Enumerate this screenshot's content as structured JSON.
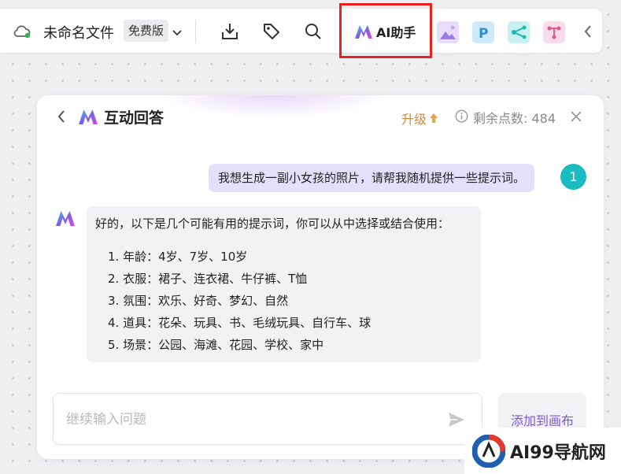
{
  "toolbar": {
    "file_name": "未命名文件",
    "plan_badge": "免费版",
    "ai_label": "AI助手",
    "icons": [
      "cloud-sync-icon",
      "chevron-down-icon",
      "download-icon",
      "tag-icon",
      "search-icon",
      "ai-logo-icon",
      "image-gen-plugin-icon",
      "p-plugin-icon",
      "mindmap-plugin-icon",
      "flowchart-plugin-icon",
      "collapse-left-icon"
    ],
    "highlight_color": "#f0201c"
  },
  "panel": {
    "title": "互动回答",
    "upgrade_label": "升级",
    "points_label": "剩余点数: 484",
    "user_avatar_text": "1",
    "user_message": "我想生成一副小女孩的照片，请帮我随机提供一些提示词。",
    "bot_intro": "好的，以下是几个可能有用的提示词，你可以从中选择或结合使用：",
    "bot_list": [
      "1. 年龄：4岁、7岁、10岁",
      "2. 衣服：裙子、连衣裙、牛仔裤、T恤",
      "3. 氛围：欢乐、好奇、梦幻、自然",
      "4. 道具：花朵、玩具、书、毛绒玩具、自行车、球",
      "5. 场景：公园、海滩、花园、学校、家中"
    ],
    "input_placeholder": "继续输入问题",
    "add_to_canvas_label": "添加到画布",
    "accent_color": "#7b56e6",
    "user_bubble_color": "#e3e0fb",
    "avatar_color": "#1bbcc1"
  },
  "watermark": {
    "text": "AI99导航网"
  }
}
